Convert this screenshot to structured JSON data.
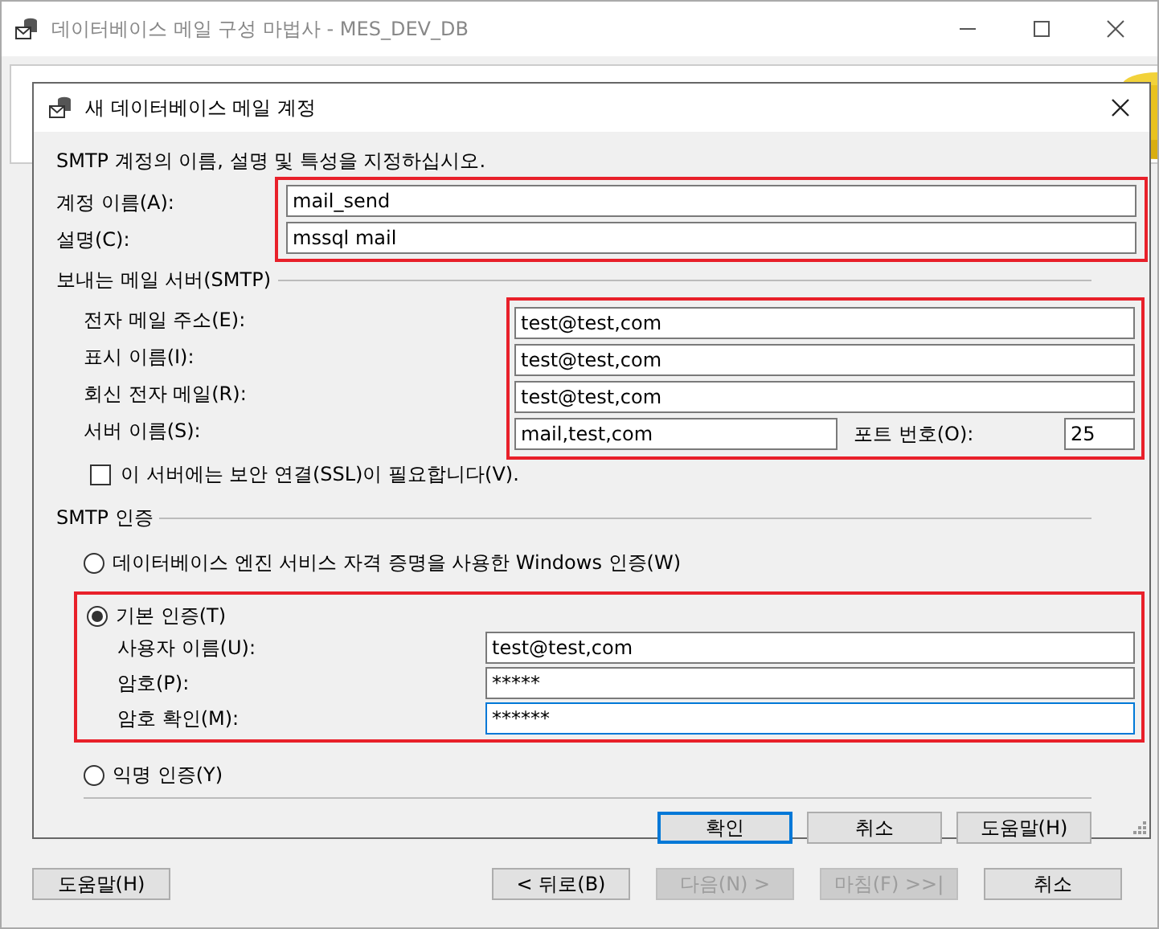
{
  "window": {
    "title": "데이터베이스 메일 구성 마법사 - MES_DEV_DB"
  },
  "dialog": {
    "title": "새 데이터베이스 메일 계정",
    "instruction": "SMTP 계정의 이름, 설명 및 특성을 지정하십시오.",
    "account_fields": [
      {
        "label": "계정 이름(A):",
        "value": "mail_send"
      },
      {
        "label": "설명(C):",
        "value": "mssql mail"
      }
    ],
    "server_section": {
      "title": "보내는 메일 서버(SMTP)",
      "fields": [
        {
          "label": "전자 메일 주소(E):",
          "value": "test@test,com"
        },
        {
          "label": "표시 이름(I):",
          "value": "test@test,com"
        },
        {
          "label": "회신 전자 메일(R):",
          "value": "test@test,com"
        }
      ],
      "server_name": {
        "label": "서버 이름(S):",
        "value": "mail,test,com"
      },
      "port": {
        "label": "포트 번호(O):",
        "value": "25"
      },
      "ssl": {
        "label": "이 서버에는 보안 연결(SSL)이 필요합니다(V).",
        "checked": false
      }
    },
    "auth_section": {
      "title": "SMTP 인증",
      "options": [
        {
          "label": "데이터베이스 엔진 서비스 자격 증명을 사용한 Windows 인증(W)",
          "selected": false,
          "highlighted": false
        },
        {
          "label": "기본 인증(T)",
          "selected": true,
          "highlighted": true,
          "fields": [
            {
              "label": "사용자 이름(U):",
              "value": "test@test,com",
              "focused": false
            },
            {
              "label": "암호(P):",
              "value": "*****",
              "focused": false
            },
            {
              "label": "암호 확인(M):",
              "value": "******",
              "focused": true
            }
          ]
        },
        {
          "label": "익명 인증(Y)",
          "selected": false,
          "highlighted": false
        }
      ]
    },
    "buttons": [
      {
        "label": "확인",
        "focused": true
      },
      {
        "label": "취소",
        "focused": false
      },
      {
        "label": "도움말(H)",
        "focused": false
      }
    ]
  },
  "wizard_buttons": [
    {
      "label": "도움말(H)",
      "disabled": false
    },
    {
      "label": "< 뒤로(B)",
      "disabled": false
    },
    {
      "label": "다음(N) >",
      "disabled": true
    },
    {
      "label": "마침(F) >>|",
      "disabled": true
    },
    {
      "label": "취소",
      "disabled": false
    }
  ]
}
